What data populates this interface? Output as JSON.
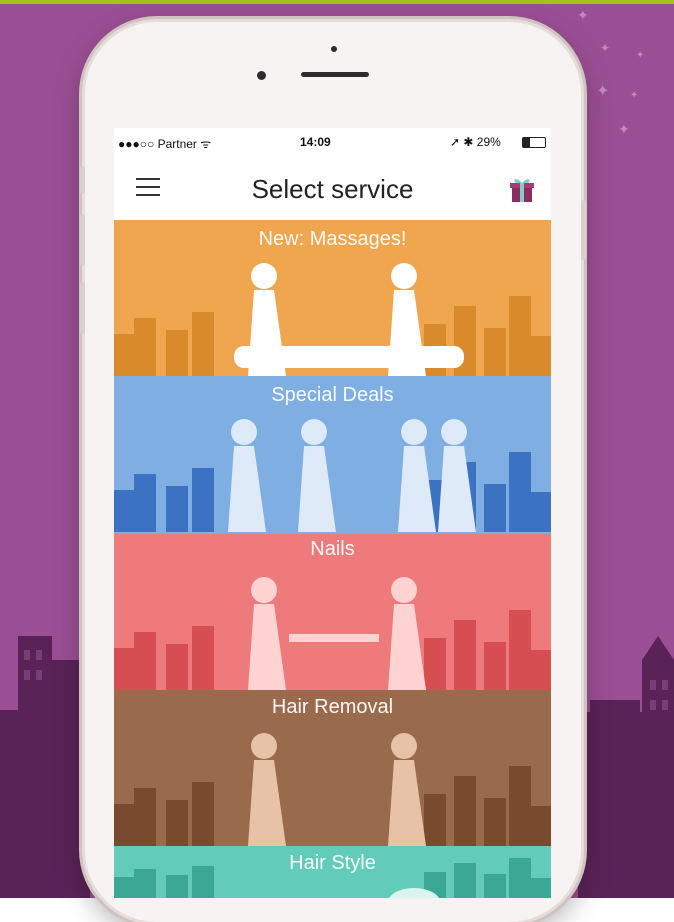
{
  "status_bar": {
    "carrier": "●●●○○ Partner ᯤ",
    "time": "14:09",
    "battery": "➚ ✱ 29%"
  },
  "header": {
    "title": "Select service"
  },
  "services": [
    {
      "label": "New: Massages!",
      "color": "#f0a54f",
      "dark": "#d98a2b",
      "figure": "#ffffff"
    },
    {
      "label": "Special Deals",
      "color": "#7faee3",
      "dark": "#3b72c2",
      "figure": "#dfeaf8"
    },
    {
      "label": "Nails",
      "color": "#ef7a7b",
      "dark": "#d64d52",
      "figure": "#ffd3d1"
    },
    {
      "label": "Hair Removal",
      "color": "#9a6a4d",
      "dark": "#7a4a2e",
      "figure": "#e8c2a6"
    },
    {
      "label": "Hair Style",
      "color": "#63cbb9",
      "dark": "#3ba896",
      "figure": "#d9f4ef"
    }
  ],
  "colors": {
    "background": "#9a4f94",
    "skyline": "#5a2358",
    "accent_line": "#a9bf1a"
  }
}
